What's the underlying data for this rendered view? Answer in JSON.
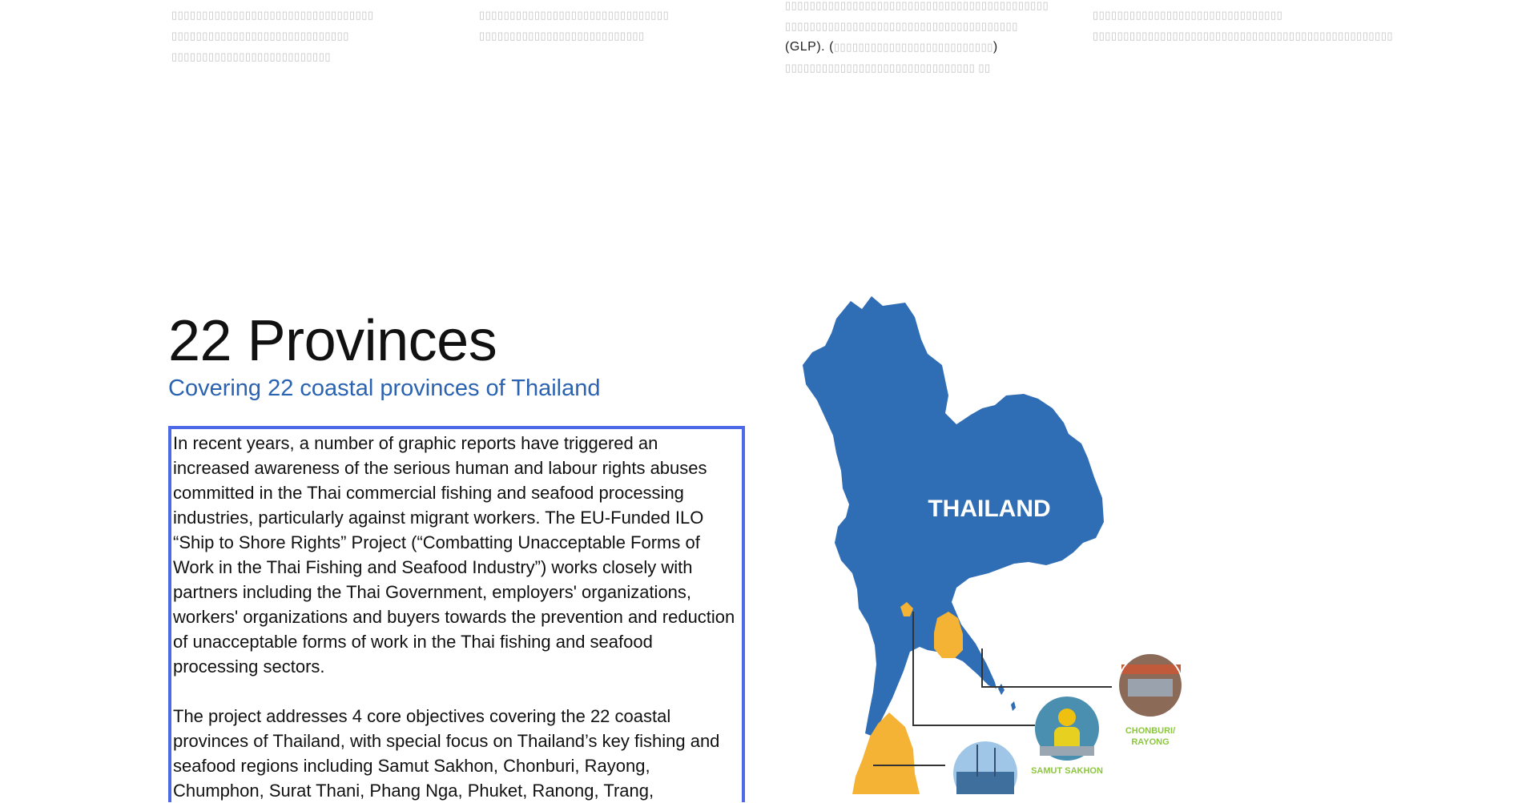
{
  "header": {
    "col1_lines": [
      "▯▯▯▯▯▯▯▯▯▯▯▯▯▯▯▯▯▯▯▯▯▯▯▯▯▯▯▯▯▯▯▯▯",
      "▯▯▯▯▯▯▯▯▯▯▯▯▯▯▯▯▯▯▯▯▯▯▯▯▯▯▯▯▯",
      "▯▯▯▯▯▯▯▯▯▯▯▯▯▯▯▯▯▯▯▯▯▯▯▯▯▯"
    ],
    "col2_lines": [
      "▯▯▯▯▯▯▯▯▯▯▯▯▯▯▯▯▯▯▯▯▯▯▯▯▯▯▯▯▯▯▯",
      "▯▯▯▯▯▯▯▯▯▯▯▯▯▯▯▯▯▯▯▯▯▯▯▯▯▯▯"
    ],
    "col3_line1": "▯▯▯▯▯▯▯▯▯▯▯▯▯▯▯▯▯▯▯▯▯▯▯▯▯▯▯▯▯▯▯▯▯▯▯▯▯▯▯▯▯▯▯",
    "col3_line2": "▯▯▯▯▯▯▯▯▯▯▯▯▯▯▯▯▯▯▯▯▯▯▯▯▯▯▯▯▯▯▯▯▯▯▯▯▯▯",
    "col3_glp_prefix": "(GLP). (",
    "col3_glp_muted": "▯▯▯▯▯▯▯▯▯▯▯▯▯▯▯▯▯▯▯▯▯▯▯▯▯▯",
    "col3_glp_suffix": ")",
    "col3_line4": "▯▯▯▯▯▯▯▯▯▯▯▯▯▯▯▯▯▯▯▯▯▯▯▯▯▯▯▯▯▯▯ ▯▯",
    "col4_lines": [
      "▯▯▯▯▯▯▯▯▯▯▯▯▯▯▯▯▯▯▯▯▯▯▯▯▯▯▯▯▯▯▯",
      "▯▯▯▯▯▯▯▯▯▯▯▯▯▯▯▯▯▯▯▯▯▯▯▯▯▯▯▯▯▯▯▯▯▯▯▯▯▯▯▯▯▯▯▯▯▯▯▯▯"
    ]
  },
  "section": {
    "title": "22 Provinces",
    "subtitle": "Covering 22 coastal provinces of Thailand"
  },
  "body": {
    "paragraph1": "In recent years, a number of graphic reports have triggered an increased awareness of the serious human and labour rights abuses committed in the Thai commercial fishing and seafood processing industries, particularly against migrant workers. The EU-Funded ILO “Ship to Shore Rights” Project (“Combatting Unacceptable Forms of Work in the Thai Fishing and Seafood Industry”) works closely with partners including the Thai Government, employers' organizations, workers' organizations and buyers towards the prevention and reduction of unacceptable forms of work in the Thai fishing and seafood processing sectors.",
    "paragraph2": "The project addresses 4 core objectives covering the 22 coastal provinces of Thailand, with special focus on Thailand’s key fishing and seafood regions including Samut Sakhon, Chonburi, Rayong, Chumphon, Surat Thani, Phang Nga, Phuket, Ranong, Trang,"
  },
  "map": {
    "country_label": "THAILAND",
    "label_chonburi_1": "CHONBURI/",
    "label_chonburi_2": "RAYONG",
    "label_samut_sakhon": "SAMUT SAKHON",
    "colors": {
      "land": "#2f6db5",
      "focus": "#f5b335",
      "caption": "#8dc63f"
    }
  }
}
